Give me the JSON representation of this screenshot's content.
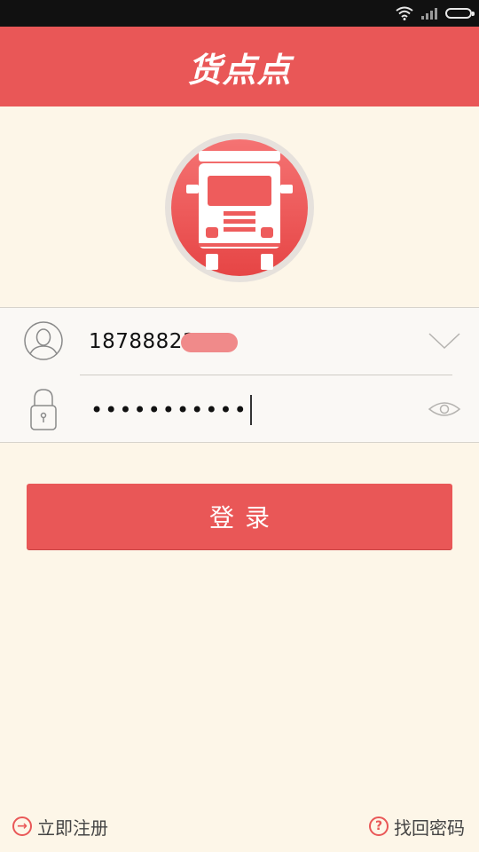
{
  "app": {
    "title": "货点点"
  },
  "login": {
    "phone_value": "18788823",
    "password_mask": "•••••••••••"
  },
  "actions": {
    "login_label": "登录",
    "register_label": "立即注册",
    "forgot_label": "找回密码"
  },
  "icons": {
    "logo": "truck-icon",
    "user": "user-avatar-icon",
    "lock": "lock-icon",
    "dropdown": "chevron-down-icon",
    "toggle_password": "eye-icon",
    "register": "arrow-circle-icon",
    "forgot": "question-circle-icon"
  },
  "colors": {
    "brand": "#e95757",
    "background": "#fdf6e8"
  }
}
